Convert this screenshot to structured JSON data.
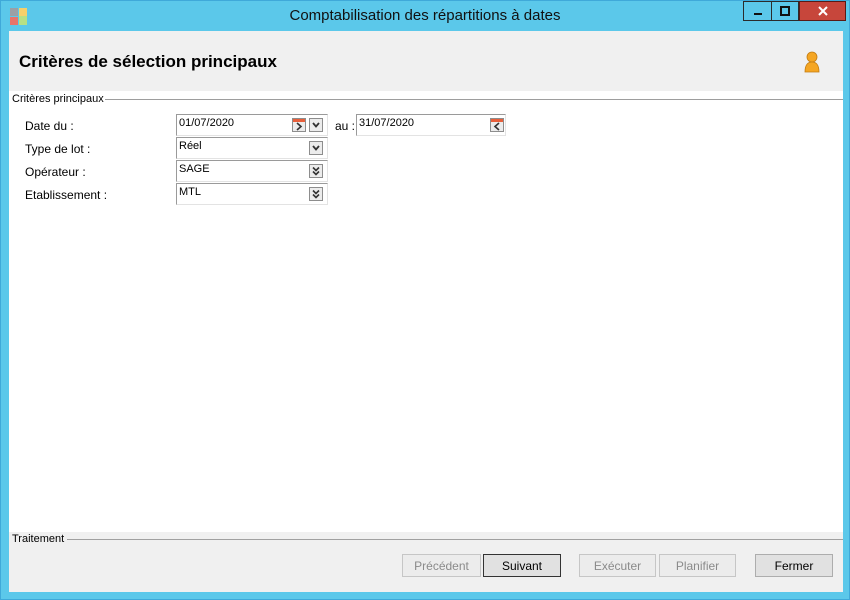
{
  "window": {
    "title": "Comptabilisation des répartitions à dates"
  },
  "header": {
    "title": "Critères de sélection principaux"
  },
  "group": {
    "label": "Critères principaux"
  },
  "fields": {
    "date_du": {
      "label": "Date du :",
      "value": "01/07/2020"
    },
    "au": {
      "label": "au :",
      "value": "31/07/2020"
    },
    "type_de_lot": {
      "label": "Type de lot :",
      "value": "Réel"
    },
    "operateur": {
      "label": "Opérateur :",
      "value": "SAGE"
    },
    "etablissement": {
      "label": "Etablissement :",
      "value": "MTL"
    }
  },
  "footer": {
    "label": "Traitement",
    "buttons": {
      "precedent": {
        "label": "Précédent",
        "enabled": false
      },
      "suivant": {
        "label": "Suivant",
        "enabled": true
      },
      "executer": {
        "label": "Exécuter",
        "enabled": false
      },
      "planifier": {
        "label": "Planifier",
        "enabled": false
      },
      "fermer": {
        "label": "Fermer",
        "enabled": true
      }
    }
  },
  "colors": {
    "titlebar": "#5bc8ea",
    "close": "#c7463b",
    "calendar": "#e8603c"
  }
}
